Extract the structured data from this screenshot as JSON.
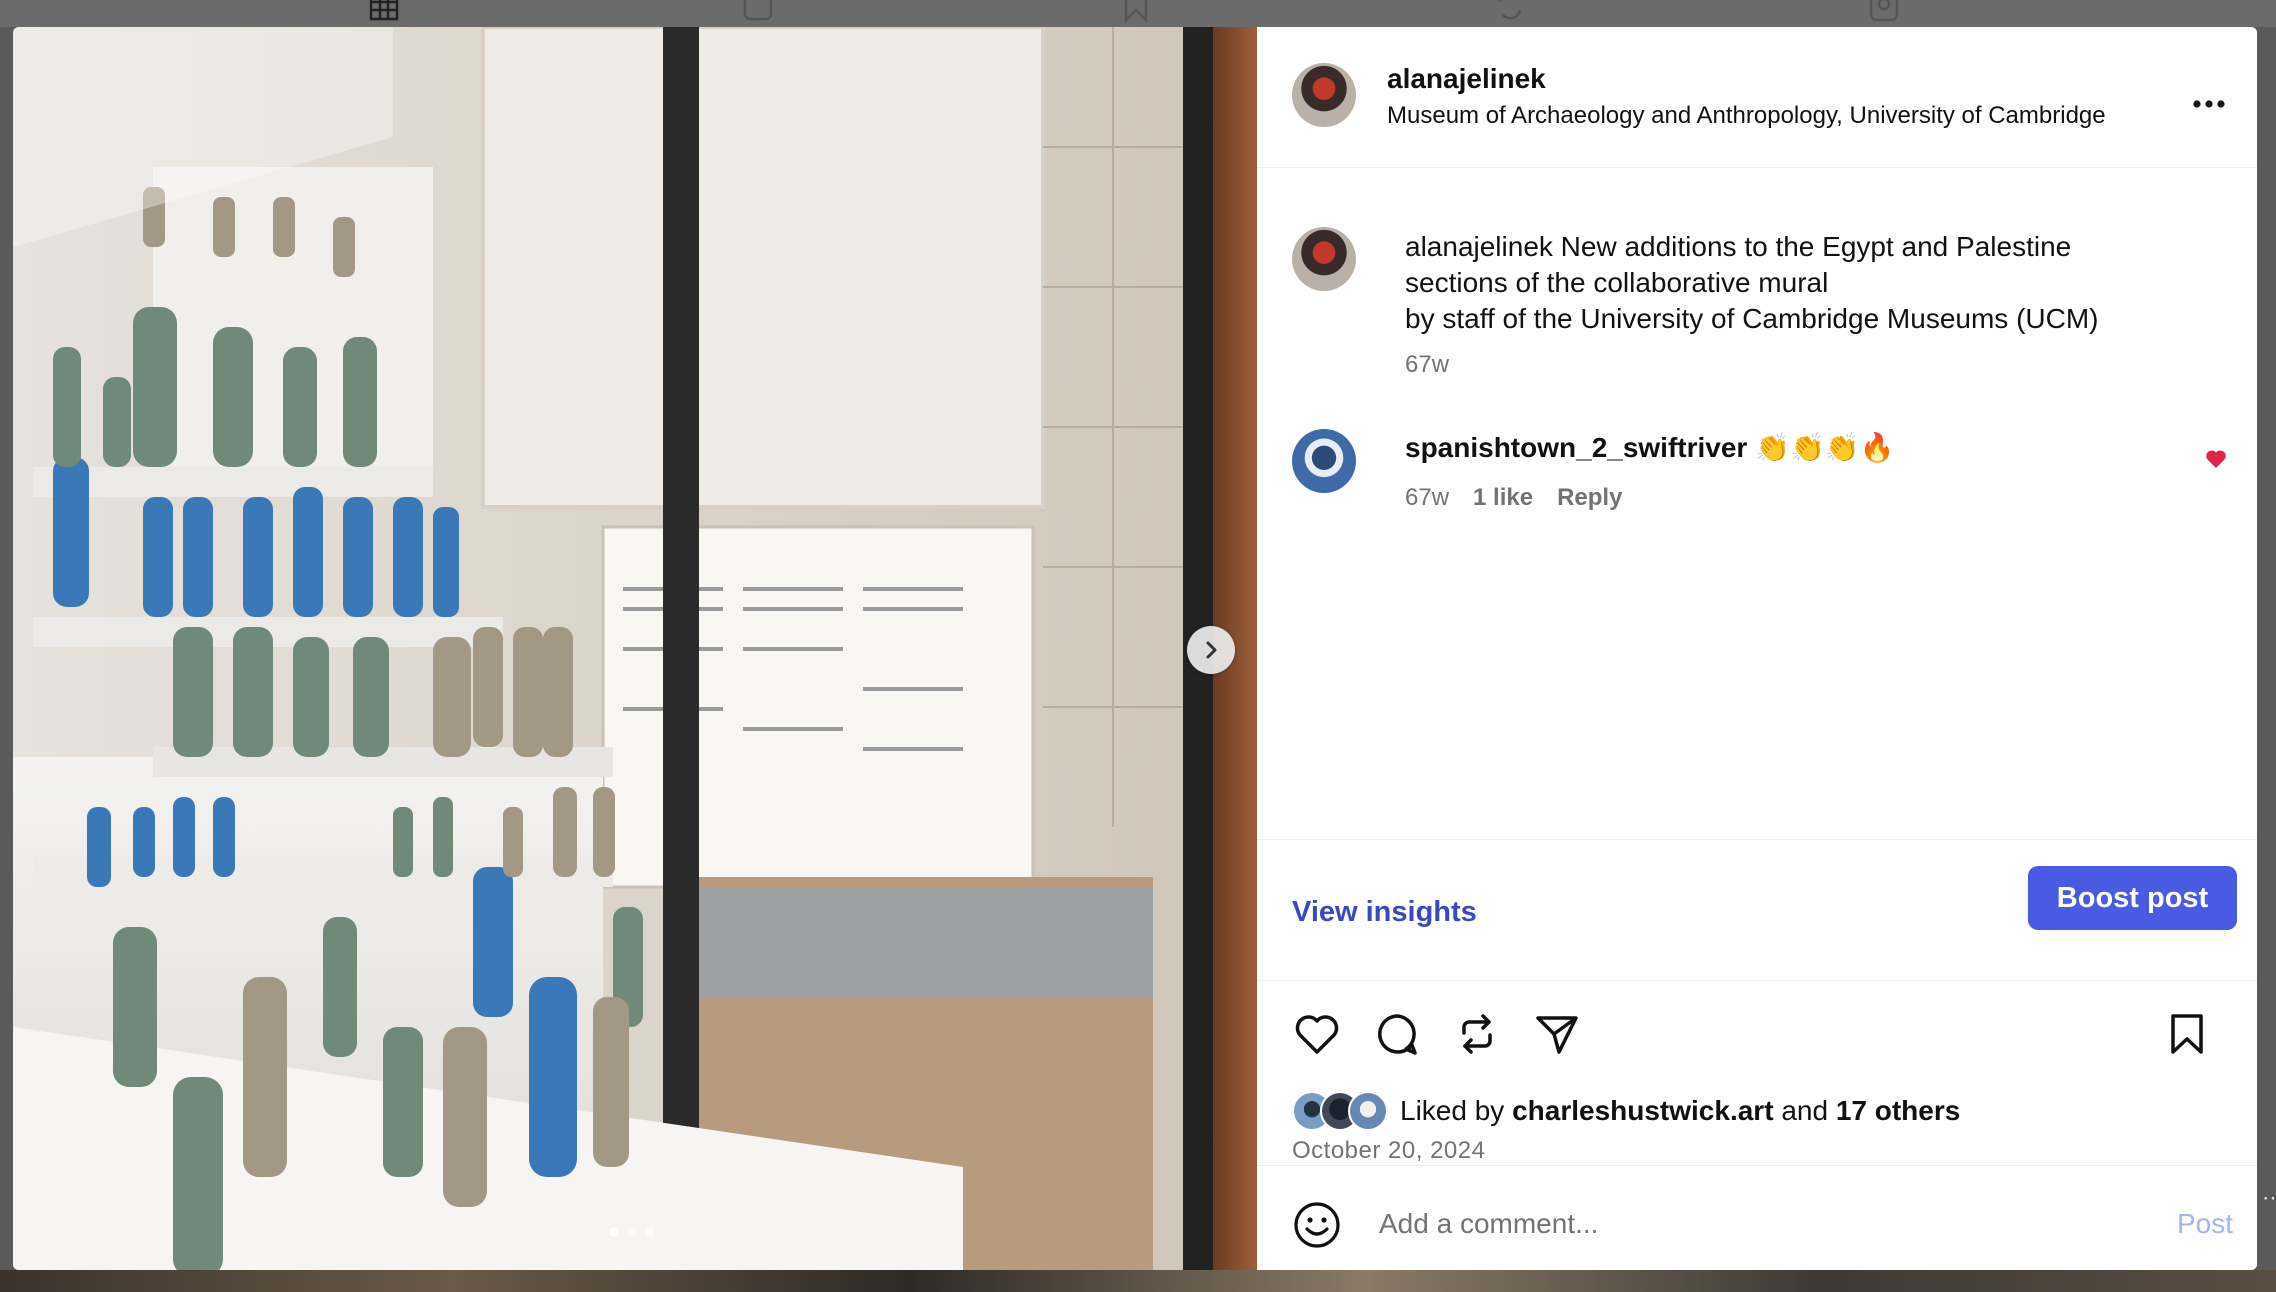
{
  "post": {
    "author": "alanajelinek",
    "location": "Museum of Archaeology and Anthropology, University of Cambridge",
    "caption_user": "alanajelinek",
    "caption_line1": "New additions to the Egypt and Palestine",
    "caption_line2": "sections of the collaborative mural",
    "caption_line3": "by staff of the University of Cambridge Museums (UCM)",
    "caption_time": "67w",
    "date": "October 20, 2024"
  },
  "comment": {
    "user": "spanishtown_2_swiftriver",
    "emojis": "👏👏👏🔥",
    "time": "67w",
    "likes": "1 like",
    "reply": "Reply"
  },
  "insights": {
    "view_label": "View insights",
    "boost_label": "Boost post"
  },
  "likes": {
    "prefix": "Liked by",
    "user": "charleshustwick.art",
    "and": "and",
    "others": "17 others"
  },
  "composer": {
    "placeholder": "Add a comment...",
    "post_label": "Post"
  },
  "carousel": {
    "slide": 1,
    "total": 3
  },
  "colors": {
    "accent": "#4a5be3",
    "link": "#3949c4",
    "heart": "#e0254a",
    "post_disabled": "#a5b4f5"
  }
}
